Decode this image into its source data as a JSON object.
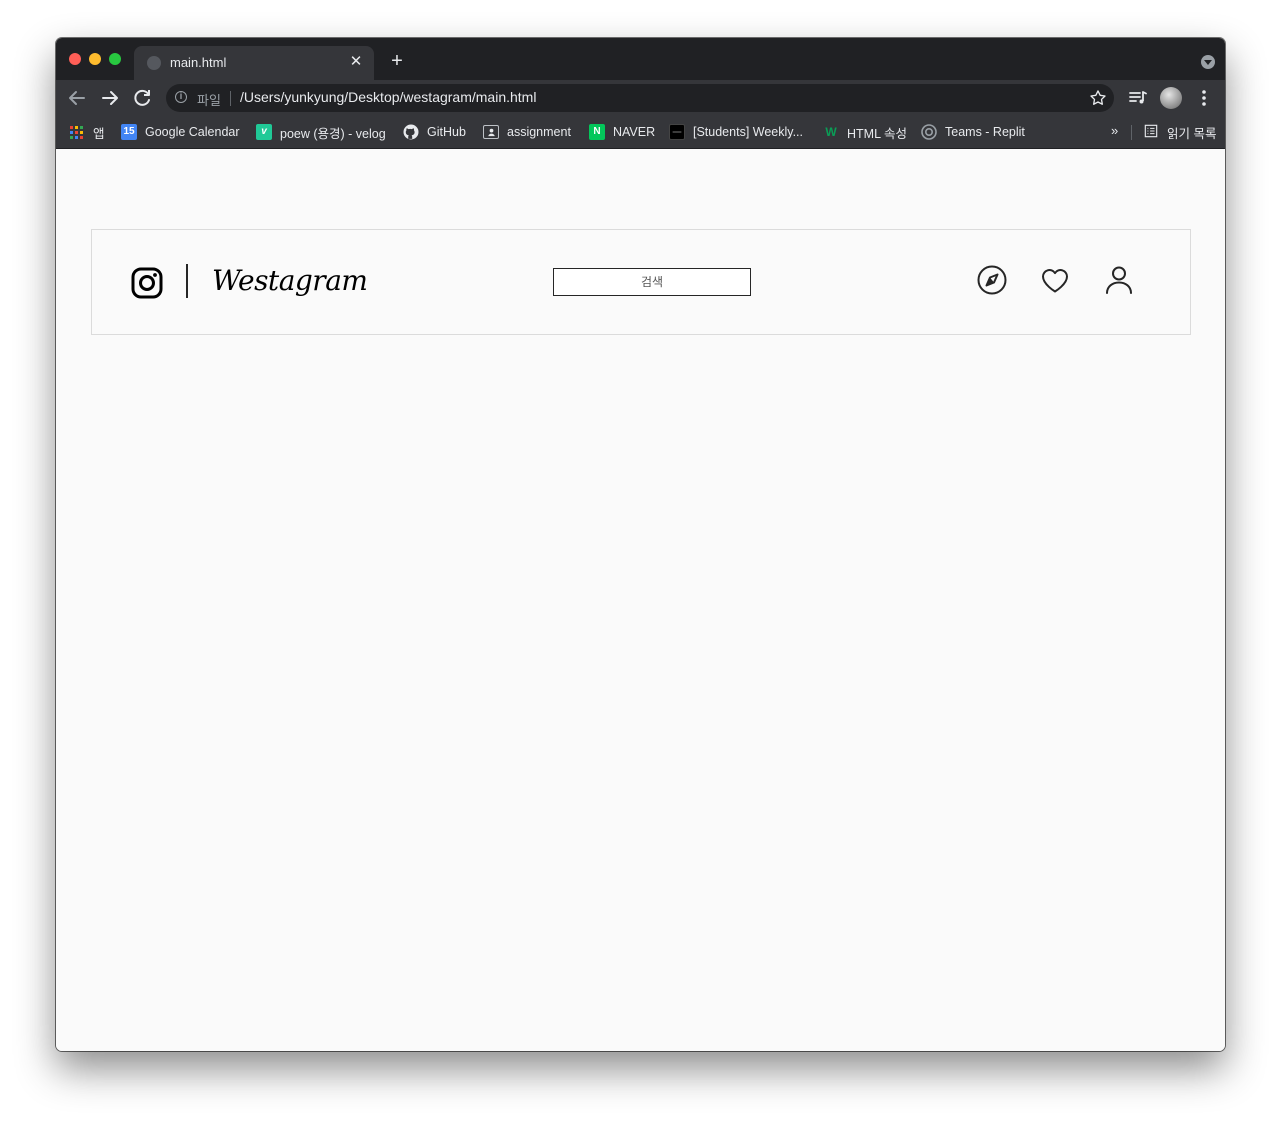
{
  "browser": {
    "tab": {
      "title": "main.html"
    },
    "address_bar": {
      "scheme_label": "파일",
      "url": "/Users/yunkyung/Desktop/westagram/main.html"
    },
    "bookmarks": [
      {
        "label": "앱",
        "icon": "apps-grid-icon"
      },
      {
        "label": "Google Calendar",
        "icon": "calendar-icon",
        "icon_text": "15",
        "color": "#4285f4"
      },
      {
        "label": "poew (용경) - velog",
        "icon": "velog-icon",
        "icon_text": "v",
        "color": "#20c997"
      },
      {
        "label": "GitHub",
        "icon": "github-icon"
      },
      {
        "label": "assignment",
        "icon": "classroom-icon"
      },
      {
        "label": "NAVER",
        "icon": "naver-icon",
        "icon_text": "N",
        "color": "#03c75a"
      },
      {
        "label": "[Students] Weekly...",
        "icon": "weekly-icon"
      },
      {
        "label": "HTML 속성",
        "icon": "w-icon",
        "icon_text": "W",
        "color": "#0a9e56"
      },
      {
        "label": "Teams - Replit",
        "icon": "replit-icon"
      }
    ],
    "bookmarks_overflow": "»",
    "reading_list": {
      "label": "읽기 목록",
      "icon": "reading-list-icon"
    }
  },
  "page": {
    "logo_icon": "instagram-icon",
    "wordmark": "Westagram",
    "search": {
      "placeholder": "검색",
      "value": ""
    },
    "nav_icons": [
      "compass-icon",
      "heart-icon",
      "user-icon"
    ]
  },
  "colors": {
    "tab_strip": "#202124",
    "toolbar": "#35363a",
    "page_bg": "#fafafa",
    "nav_border": "#dbdbdb",
    "icon": "#262626"
  }
}
